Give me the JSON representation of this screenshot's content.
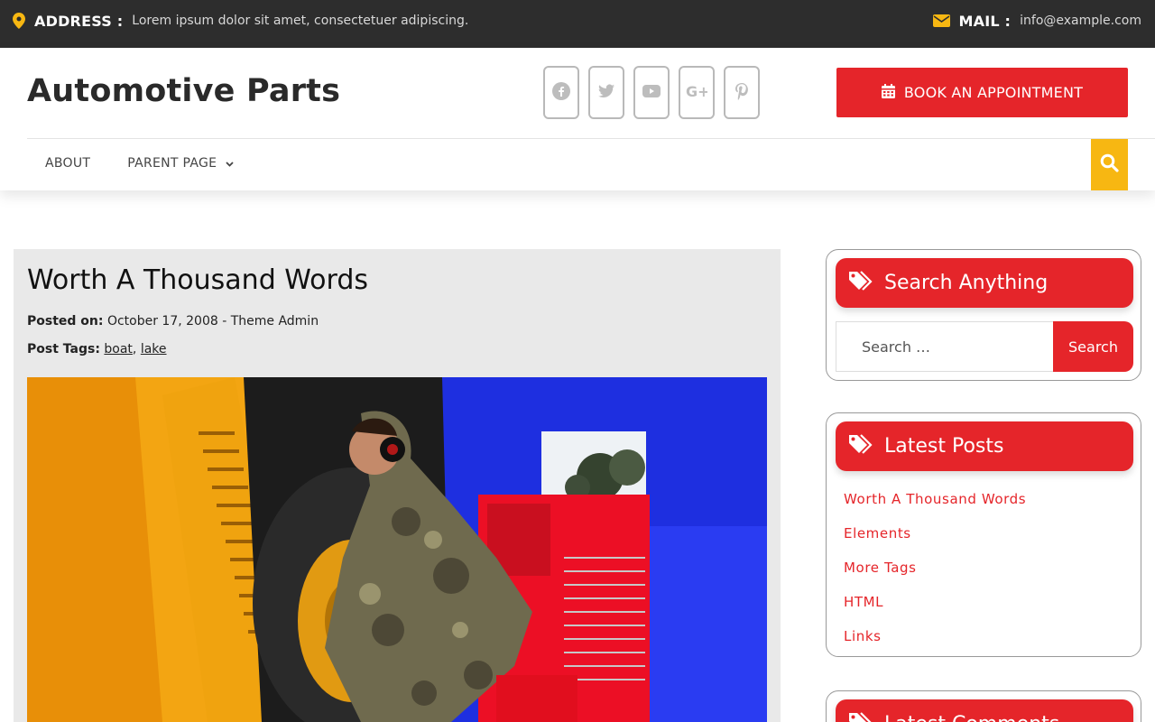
{
  "topbar": {
    "address_label": "ADDRESS :",
    "address_value": "Lorem ipsum dolor sit amet, consectetuer adipiscing.",
    "mail_label": "MAIL :",
    "mail_value": "info@example.com"
  },
  "header": {
    "site_title": "Automotive Parts",
    "socials": [
      "facebook-icon",
      "twitter-icon",
      "youtube-icon",
      "google-plus-icon",
      "pinterest-icon"
    ],
    "cta_label": "BOOK AN APPOINTMENT"
  },
  "nav": {
    "items": [
      {
        "label": "ABOUT"
      },
      {
        "label": "PARENT PAGE"
      }
    ]
  },
  "post": {
    "title": "Worth A Thousand Words",
    "posted_label": "Posted on:",
    "posted_value": "October 17, 2008 - Theme Admin",
    "tags_label": "Post Tags:",
    "tags": [
      "boat",
      "lake"
    ]
  },
  "sidebar": {
    "search_title": "Search Anything",
    "search_placeholder": "Search …",
    "search_button": "Search",
    "latest_title": "Latest Posts",
    "latest_posts": [
      "Worth A Thousand Words",
      "Elements",
      "More Tags",
      "HTML",
      "Links"
    ],
    "comments_title": "Latest Comments"
  },
  "colors": {
    "accent_red": "#e5252a",
    "accent_yellow": "#f7b712",
    "topbar_bg": "#2d2d2d"
  }
}
